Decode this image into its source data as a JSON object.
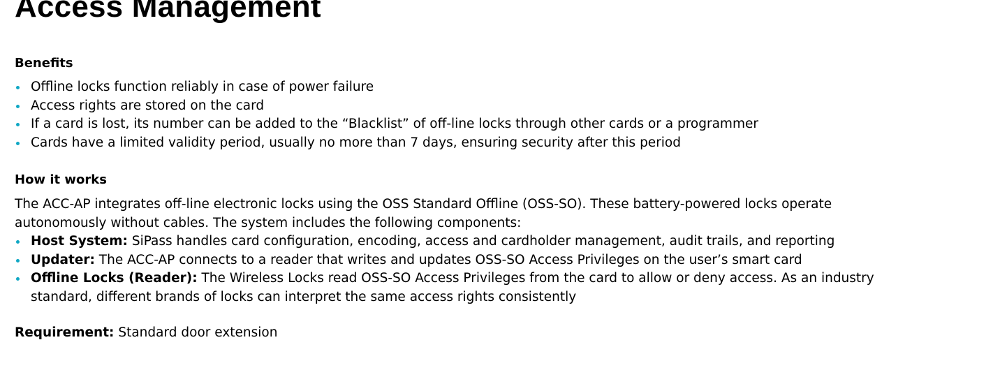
{
  "page_title": "Access Management",
  "benefits": {
    "heading": "Benefits",
    "items": [
      "Offline locks function reliably in case of power failure",
      "Access rights are stored on the card",
      "If a card is lost, its number can be added to the “Blacklist” of off-line locks through other cards or a programmer",
      "Cards have a limited validity period, usually no more than 7 days, ensuring security after this period"
    ]
  },
  "how_it_works": {
    "heading": "How it works",
    "intro": "The ACC-AP integrates off-line electronic locks using the OSS Standard Offline (OSS-SO). These battery-powered locks operate autonomously without cables. The system includes the following components:",
    "components": [
      {
        "term": "Host System:",
        "description": " SiPass handles card configuration, encoding, access and cardholder management, audit trails, and reporting"
      },
      {
        "term": "Updater:",
        "description": " The ACC-AP connects to a reader that writes and updates OSS-SO Access Privileges on the user’s smart card"
      },
      {
        "term": "Offline Locks (Reader):",
        "description": " The Wireless Locks read OSS-SO Access Privileges from the card to allow or deny access. As an industry standard, different brands of locks can interpret the same access rights consistently"
      }
    ]
  },
  "requirement": {
    "label": "Requirement:",
    "value": " Standard door extension"
  },
  "colors": {
    "bullet": "#0fa7c4",
    "text": "#000000",
    "background": "#ffffff"
  }
}
